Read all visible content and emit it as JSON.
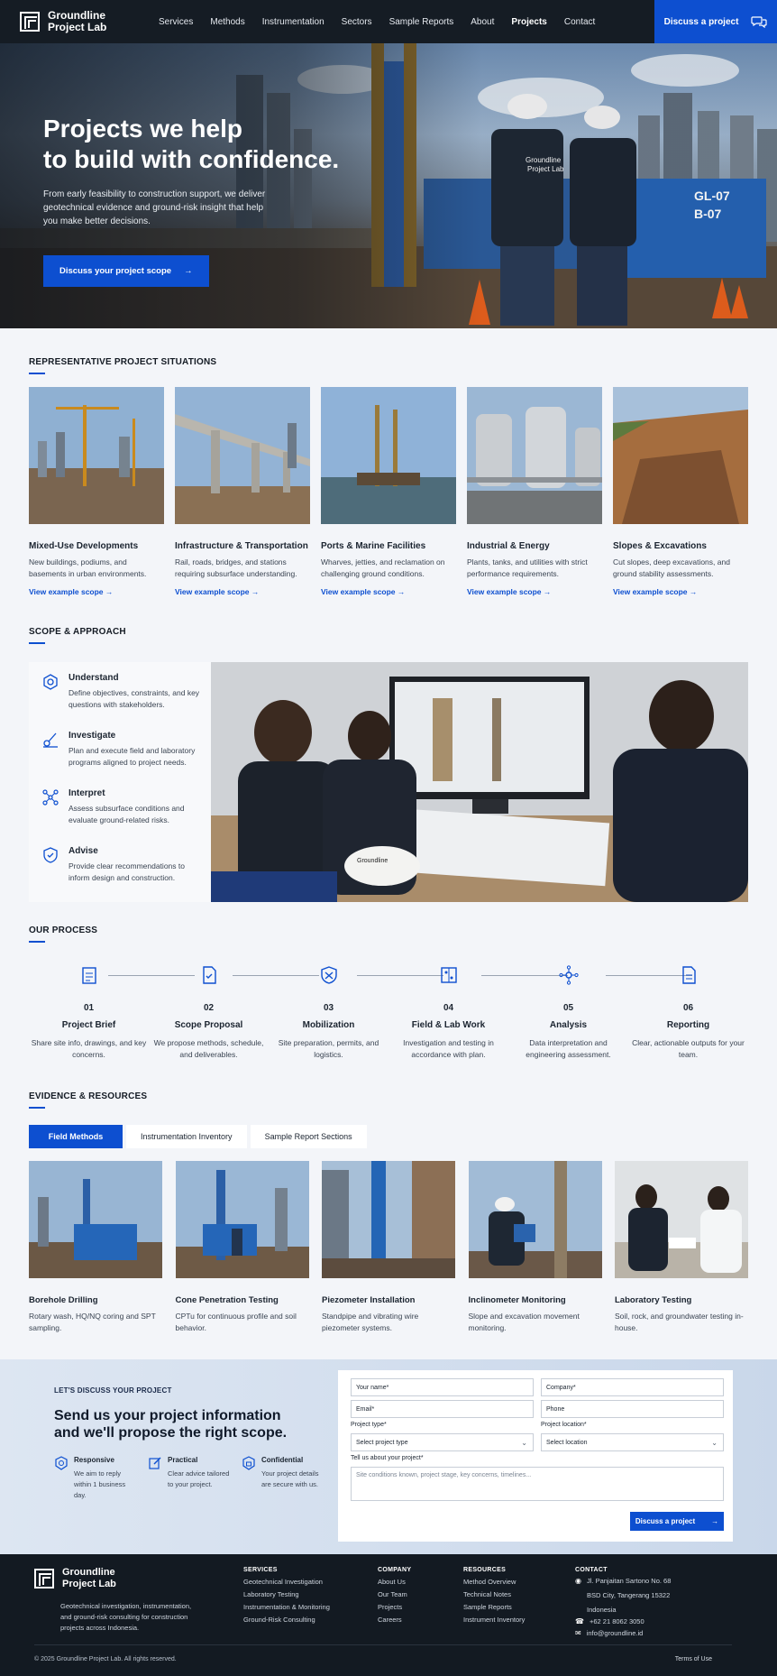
{
  "brand": {
    "line1": "Groundline",
    "line2": "Project Lab"
  },
  "nav": {
    "links": [
      "Services",
      "Methods",
      "Instrumentation",
      "Sectors",
      "Sample Reports",
      "About",
      "Projects",
      "Contact"
    ],
    "active": "Projects",
    "cta": "Discuss a project"
  },
  "hero": {
    "title_line1": "Projects we help",
    "title_line2": "to build with confidence.",
    "subtitle": "From early feasibility to construction support, we deliver geotechnical evidence and ground-risk insight that help you make better decisions.",
    "button": "Discuss your project scope",
    "jacket_text": "Groundline Project Lab",
    "rig_label": "GL-07 B-07"
  },
  "situations": {
    "title": "REPRESENTATIVE PROJECT SITUATIONS",
    "cards": [
      {
        "title": "Mixed-Use Developments",
        "text": "New buildings, podiums, and basements in urban environments.",
        "link": "View example scope"
      },
      {
        "title": "Infrastructure & Transportation",
        "text": "Rail, roads, bridges, and stations requiring subsurface understanding.",
        "link": "View example scope"
      },
      {
        "title": "Ports & Marine Facilities",
        "text": "Wharves, jetties, and reclamation on challenging ground conditions.",
        "link": "View example scope"
      },
      {
        "title": "Industrial & Energy",
        "text": "Plants, tanks, and utilities with strict performance requirements.",
        "link": "View example scope"
      },
      {
        "title": "Slopes & Excavations",
        "text": "Cut slopes, deep excavations, and ground stability assessments.",
        "link": "View example scope"
      }
    ]
  },
  "scope": {
    "title": "SCOPE & APPROACH",
    "items": [
      {
        "title": "Understand",
        "text": "Define objectives, constraints, and key questions with stakeholders."
      },
      {
        "title": "Investigate",
        "text": "Plan and execute field and laboratory programs aligned to project needs."
      },
      {
        "title": "Interpret",
        "text": "Assess subsurface conditions and evaluate ground-related risks."
      },
      {
        "title": "Advise",
        "text": "Provide clear recommendations to inform design and construction."
      }
    ],
    "helmet_text": "Groundline Project Lab"
  },
  "process": {
    "title": "OUR PROCESS",
    "steps": [
      {
        "num": "01",
        "title": "Project Brief",
        "text": "Share site info, drawings, and key concerns."
      },
      {
        "num": "02",
        "title": "Scope Proposal",
        "text": "We propose methods, schedule, and deliverables."
      },
      {
        "num": "03",
        "title": "Mobilization",
        "text": "Site preparation, permits, and logistics."
      },
      {
        "num": "04",
        "title": "Field & Lab Work",
        "text": "Investigation and testing in accordance with plan."
      },
      {
        "num": "05",
        "title": "Analysis",
        "text": "Data interpretation and engineering assessment."
      },
      {
        "num": "06",
        "title": "Reporting",
        "text": "Clear, actionable outputs for your team."
      }
    ]
  },
  "evidence": {
    "title": "EVIDENCE & RESOURCES",
    "tabs": [
      "Field Methods",
      "Instrumentation Inventory",
      "Sample Report Sections"
    ],
    "active_tab": "Field Methods",
    "cards": [
      {
        "title": "Borehole Drilling",
        "text": "Rotary wash, HQ/NQ coring and SPT sampling."
      },
      {
        "title": "Cone Penetration Testing",
        "text": "CPTu for continuous profile and soil behavior."
      },
      {
        "title": "Piezometer Installation",
        "text": "Standpipe and vibrating wire piezometer systems."
      },
      {
        "title": "Inclinometer Monitoring",
        "text": "Slope and excavation movement monitoring."
      },
      {
        "title": "Laboratory Testing",
        "text": "Soil, rock, and groundwater testing in-house."
      }
    ]
  },
  "contact": {
    "kicker": "LET'S DISCUSS YOUR PROJECT",
    "heading_line1": "Send us your project information",
    "heading_line2": "and we'll propose the right scope.",
    "benefits": [
      {
        "title": "Responsive",
        "text": "We aim to reply within 1 business day."
      },
      {
        "title": "Practical",
        "text": "Clear advice tailored to your project."
      },
      {
        "title": "Confidential",
        "text": "Your project details are secure with us."
      }
    ],
    "form": {
      "your_name": "Your name*",
      "company": "Company*",
      "email": "Email*",
      "phone": "Phone",
      "project_type_label": "Project type*",
      "project_type_value": "Select project type",
      "project_location_label": "Project location*",
      "project_location_value": "Select location",
      "message_label": "Tell us about your project*",
      "message_placeholder": "Site conditions known, project stage, key concerns, timelines...",
      "submit": "Discuss a project"
    }
  },
  "footer": {
    "tagline": "Geotechnical investigation, instrumentation, and ground-risk consulting for construction projects across Indonesia.",
    "columns": [
      {
        "title": "SERVICES",
        "links": [
          "Geotechnical Investigation",
          "Laboratory Testing",
          "Instrumentation & Monitoring",
          "Ground-Risk Consulting"
        ]
      },
      {
        "title": "COMPANY",
        "links": [
          "About Us",
          "Our Team",
          "Projects",
          "Careers"
        ]
      },
      {
        "title": "RESOURCES",
        "links": [
          "Method Overview",
          "Technical Notes",
          "Sample Reports",
          "Instrument Inventory"
        ]
      }
    ],
    "contact_title": "CONTACT",
    "address_line1": "Jl. Panjaitan Sartono No. 68",
    "address_line2": "BSD City, Tangerang 15322",
    "address_line3": "Indonesia",
    "phone": "+62 21 8062 3050",
    "email": "info@groundline.id",
    "copyright": "© 2025 Groundline Project Lab. All rights reserved.",
    "terms": "Terms of Use"
  },
  "colors": {
    "accent": "#0d4fd0",
    "nav_bg": "#151c24",
    "footer_bg": "#131a22"
  }
}
